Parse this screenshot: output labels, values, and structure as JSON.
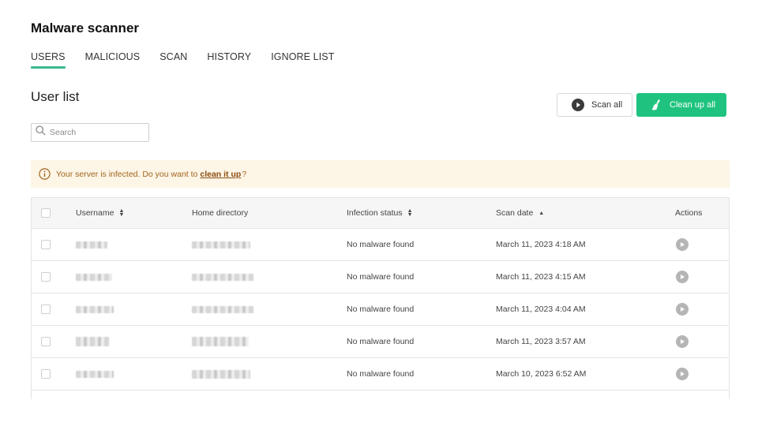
{
  "header": {
    "title": "Malware scanner"
  },
  "tabs": [
    {
      "label": "USERS",
      "active": true
    },
    {
      "label": "MALICIOUS",
      "active": false
    },
    {
      "label": "SCAN",
      "active": false
    },
    {
      "label": "HISTORY",
      "active": false
    },
    {
      "label": "IGNORE LIST",
      "active": false
    }
  ],
  "section": {
    "title": "User list"
  },
  "toolbar": {
    "scan_all_label": "Scan all",
    "clean_up_all_label": "Clean up all",
    "clean_color": "#1fc37f"
  },
  "search": {
    "placeholder": "Search",
    "value": ""
  },
  "alert": {
    "text": "Your server is infected. Do you want to",
    "link": "clean it up",
    "suffix": "?"
  },
  "table": {
    "columns": {
      "username": "Username",
      "home": "Home directory",
      "status": "Infection status",
      "date": "Scan date",
      "actions": "Actions"
    },
    "rows": [
      {
        "username": "[redacted]",
        "home": "[redacted]",
        "status": "No malware found",
        "date": "March 11, 2023 4:18 AM"
      },
      {
        "username": "[redacted]",
        "home": "[redacted]",
        "status": "No malware found",
        "date": "March 11, 2023 4:15 AM"
      },
      {
        "username": "[redacted]",
        "home": "[redacted]",
        "status": "No malware found",
        "date": "March 11, 2023 4:04 AM"
      },
      {
        "username": "[redacted]",
        "home": "[redacted]",
        "status": "No malware found",
        "date": "March 11, 2023 3:57 AM"
      },
      {
        "username": "[redacted]",
        "home": "[redacted]",
        "status": "No malware found",
        "date": "March 10, 2023 6:52 AM"
      }
    ]
  }
}
